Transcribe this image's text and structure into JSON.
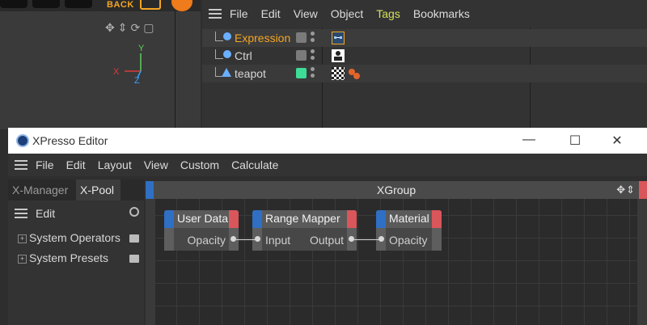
{
  "toolbar": {
    "back_label": "BACK"
  },
  "viewport": {
    "nav_icons": "✥⇕⟳▢",
    "axes": {
      "x": "X",
      "y": "Y",
      "z": "Z"
    }
  },
  "object_manager": {
    "menu": [
      "File",
      "Edit",
      "View",
      "Object",
      "Tags",
      "Bookmarks"
    ],
    "active_menu": "Tags",
    "objects": [
      {
        "name": "Expression",
        "selected": true,
        "color": "#f5a623"
      },
      {
        "name": "Ctrl",
        "selected": false,
        "color": "#d6d6d6"
      },
      {
        "name": "teapot",
        "selected": false,
        "color": "#d6d6d6"
      }
    ]
  },
  "xpresso": {
    "title": "XPresso Editor",
    "menu": [
      "File",
      "Edit",
      "Layout",
      "View",
      "Custom",
      "Calculate"
    ],
    "tabs": [
      "X-Manager",
      "X-Pool"
    ],
    "active_tab": "X-Pool",
    "pool_menu": "Edit",
    "pool_items": [
      "System Operators",
      "System Presets"
    ],
    "group_title": "XGroup",
    "nodes": [
      {
        "title": "User Data",
        "outputs": [
          "Opacity"
        ],
        "inputs": []
      },
      {
        "title": "Range Mapper",
        "inputs": [
          "Input"
        ],
        "outputs": [
          "Output"
        ]
      },
      {
        "title": "Material",
        "inputs": [
          "Opacity"
        ],
        "outputs": []
      }
    ],
    "window_controls": {
      "minimize": "—",
      "maximize": "☐",
      "close": "✕"
    }
  },
  "colors": {
    "accent_orange": "#f5a623",
    "menu_active": "#d7e15a",
    "port_in": "#2f6fc4",
    "port_out": "#d9565a"
  }
}
